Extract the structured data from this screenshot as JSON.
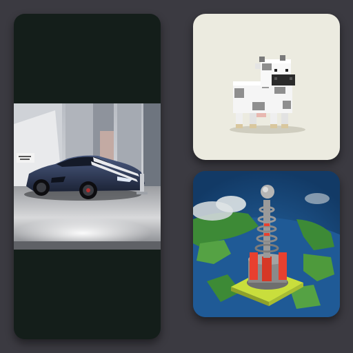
{
  "gallery": {
    "items": [
      {
        "name": "sports-car-showroom-image",
        "icon": "car-image",
        "colors": {
          "frame": "#141e1a",
          "car": "#2a3550",
          "floor": "#cfd0d2"
        }
      },
      {
        "name": "voxel-cow-image",
        "icon": "cow-image",
        "colors": {
          "background": "#ecebe0",
          "body": "#f4f4f4",
          "spots": "#8d8d8d",
          "muzzle": "#2c2c2c"
        }
      },
      {
        "name": "voxel-tower-globe-image",
        "icon": "tower-image",
        "colors": {
          "background": "#1a4779",
          "land": "#3f8a3a",
          "tower": "#8a8a8a",
          "accent": "#e8402f",
          "base": "#c7dd3f"
        }
      }
    ]
  }
}
